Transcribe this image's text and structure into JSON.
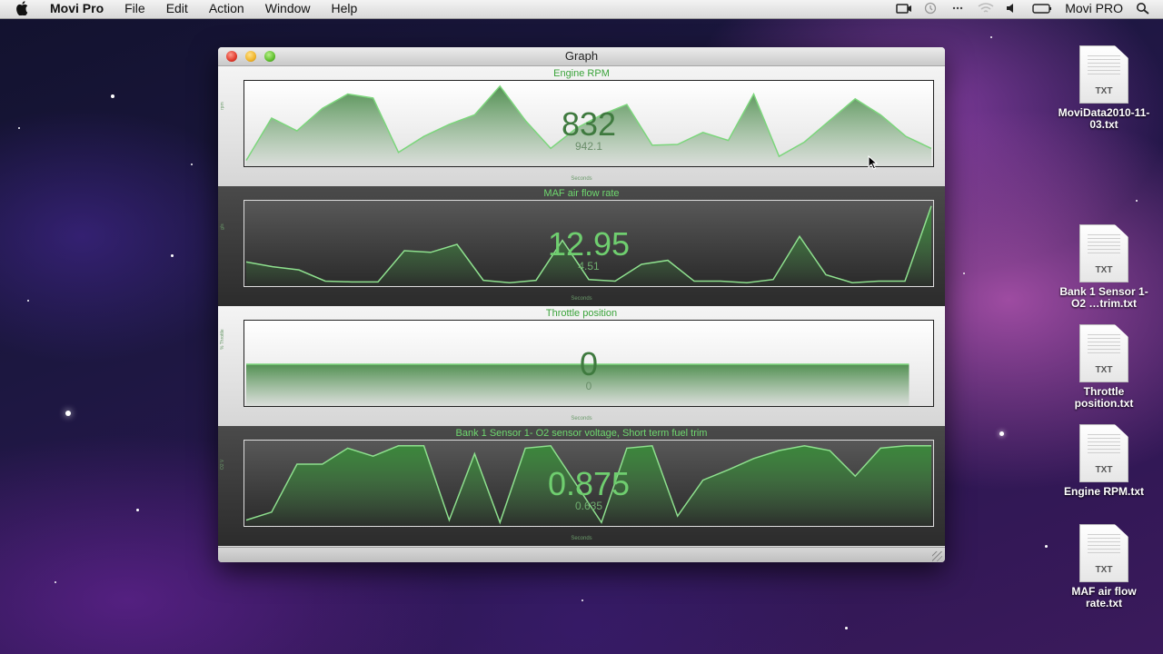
{
  "menubar": {
    "apple_icon": "apple-logo-icon",
    "app_name": "Movi Pro",
    "items": [
      "File",
      "Edit",
      "Action",
      "Window",
      "Help"
    ],
    "right_label": "Movi PRO",
    "status_icons": [
      "camera-icon",
      "time-machine-icon",
      "bluetooth-icon",
      "wifi-icon",
      "volume-icon",
      "battery-icon",
      "spotlight-icon"
    ]
  },
  "window": {
    "title": "Graph",
    "panels": [
      {
        "title": "Engine RPM",
        "value": "832",
        "subvalue": "942.1",
        "xlabel": "Seconds",
        "ylabel": "rpm",
        "theme": "light",
        "points": [
          0.05,
          0.58,
          0.42,
          0.7,
          0.88,
          0.83,
          0.15,
          0.35,
          0.5,
          0.62,
          0.98,
          0.55,
          0.2,
          0.45,
          0.62,
          0.75,
          0.24,
          0.25,
          0.4,
          0.3,
          0.88,
          0.1,
          0.28,
          0.55,
          0.82,
          0.62,
          0.35,
          0.2
        ]
      },
      {
        "title": "MAF air flow rate",
        "value": "12.95",
        "subvalue": "4.51",
        "xlabel": "Seconds",
        "ylabel": "g/s",
        "theme": "dark",
        "points": [
          0.28,
          0.22,
          0.18,
          0.04,
          0.03,
          0.03,
          0.42,
          0.4,
          0.5,
          0.05,
          0.02,
          0.05,
          0.55,
          0.06,
          0.04,
          0.25,
          0.3,
          0.04,
          0.04,
          0.02,
          0.06,
          0.6,
          0.12,
          0.02,
          0.04,
          0.04,
          0.98
        ]
      },
      {
        "title": "Throttle position",
        "value": "0",
        "subvalue": "0",
        "xlabel": "Seconds",
        "ylabel": "% Throttle",
        "theme": "light",
        "points": [
          0.5,
          0.5,
          0.5,
          0.5,
          0.5,
          0.5,
          0.5,
          0.5,
          0.5,
          0.5,
          0.5,
          0.5,
          0.5,
          0.5,
          0.5,
          0.5,
          0.5,
          0.5,
          0.5,
          0.5,
          0.5,
          0.5,
          0.5,
          0.5,
          0.5,
          0.5,
          0.5
        ]
      },
      {
        "title": "Bank 1 Sensor 1- O2 sensor voltage, Short term fuel trim",
        "value": "0.875",
        "subvalue": "0.635",
        "xlabel": "Seconds",
        "ylabel": "O2 V",
        "theme": "dark",
        "points": [
          0.05,
          0.15,
          0.75,
          0.75,
          0.95,
          0.85,
          0.98,
          0.98,
          0.05,
          0.88,
          0.02,
          0.95,
          0.98,
          0.5,
          0.02,
          0.95,
          0.98,
          0.1,
          0.55,
          0.68,
          0.82,
          0.92,
          0.98,
          0.92,
          0.6,
          0.95,
          0.98,
          0.98
        ]
      }
    ]
  },
  "desktop_icons": [
    {
      "label": "MoviData2010-11-03.txt",
      "ext": "TXT"
    },
    {
      "label": "Bank 1 Sensor 1- O2 …trim.txt",
      "ext": "TXT"
    },
    {
      "label": "Throttle position.txt",
      "ext": "TXT"
    },
    {
      "label": "Engine RPM.txt",
      "ext": "TXT"
    },
    {
      "label": "MAF air flow rate.txt",
      "ext": "TXT"
    }
  ],
  "colors": {
    "line_light": "#7cd67c",
    "fill_light": "#4a8a4a",
    "line_dark": "#8ee08e",
    "fill_dark": "#3a8a3a"
  }
}
